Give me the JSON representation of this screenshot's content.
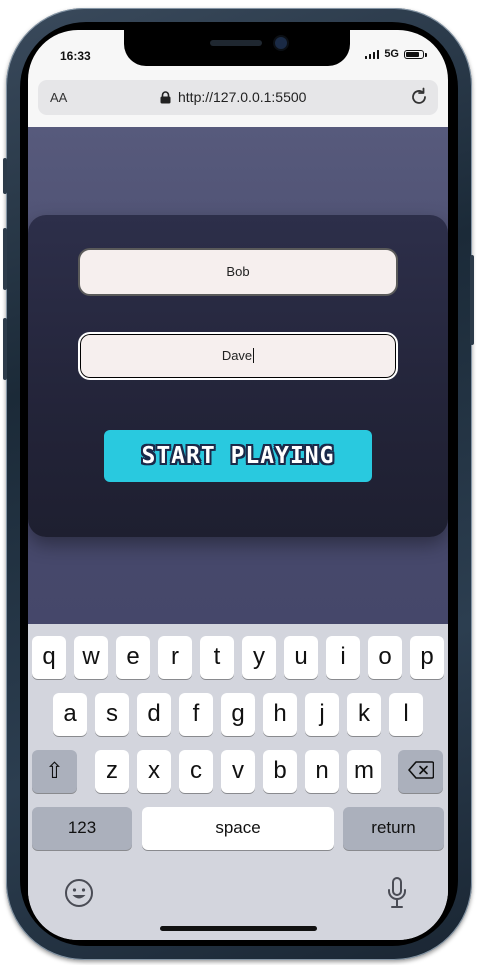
{
  "status_bar": {
    "time": "16:33",
    "network": "5G"
  },
  "browser": {
    "text_size_label": "AA",
    "url": "http://127.0.0.1:5500"
  },
  "form": {
    "player1_value": "Bob",
    "player2_value": "Dave",
    "start_label": "START PLAYING"
  },
  "keyboard": {
    "row1": [
      "q",
      "w",
      "e",
      "r",
      "t",
      "y",
      "u",
      "i",
      "o",
      "p"
    ],
    "row2": [
      "a",
      "s",
      "d",
      "f",
      "g",
      "h",
      "j",
      "k",
      "l"
    ],
    "row3": [
      "z",
      "x",
      "c",
      "v",
      "b",
      "n",
      "m"
    ],
    "shift_glyph": "⇧",
    "numbers_label": "123",
    "space_label": "space",
    "return_label": "return"
  },
  "icons": {
    "lock": "lock-icon",
    "reload": "reload-icon",
    "emoji": "emoji-icon",
    "mic": "microphone-icon",
    "backspace": "backspace-icon"
  }
}
